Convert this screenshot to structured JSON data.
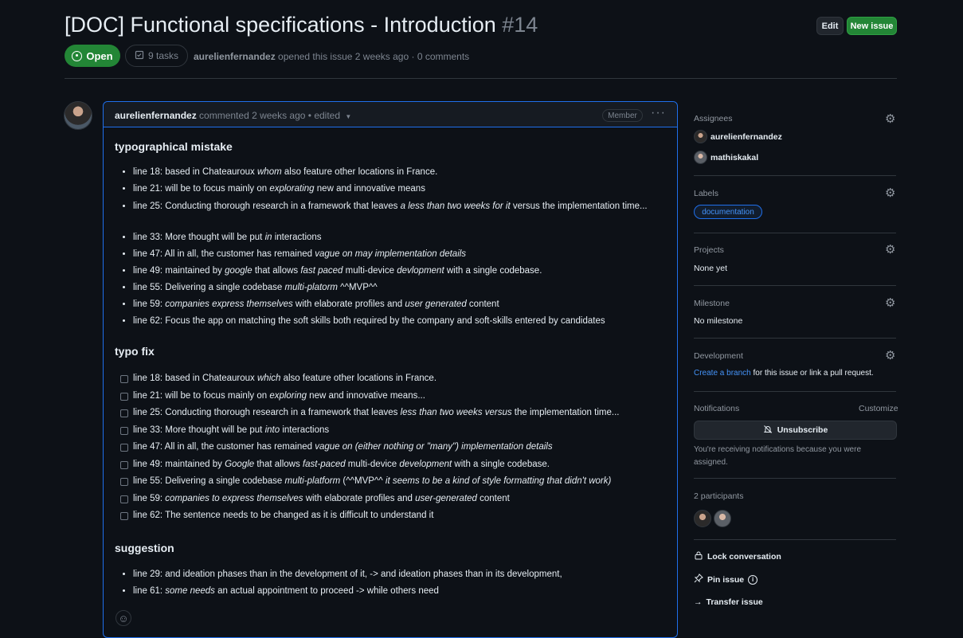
{
  "issue": {
    "title": "[DOC] Functional specifications - Introduction",
    "number": "#14",
    "status": "Open",
    "tasks": "9 tasks",
    "author": "aurelienfernandez",
    "opened_text": "opened this issue 2 weeks ago · 0 comments",
    "edit_label": "Edit",
    "new_issue_label": "New issue"
  },
  "comment": {
    "author": "aurelienfernandez",
    "meta": "commented 2 weeks ago • edited",
    "role": "Member",
    "menu": "···",
    "sections": {
      "typo_mistake": {
        "heading": "typographical mistake",
        "items": [
          [
            "line 18: based in Chateauroux ",
            "whom",
            " also feature other locations in France."
          ],
          [
            "line 21: will be to focus mainly on ",
            "explorating",
            " new and innovative means"
          ],
          [
            "line 25: Conducting thorough research in a framework that leaves ",
            "a less than two weeks for it",
            " versus the implementation time..."
          ],
          [
            "line 33: More thought will be put ",
            "in",
            " interactions"
          ],
          [
            "line 47: All in all, the customer has remained ",
            "vague on may implementation details",
            ""
          ],
          [
            "line 49: maintained by ",
            "google",
            " that allows ",
            "fast paced",
            " multi-device ",
            "devlopment",
            " with a single codebase."
          ],
          [
            "line 55: Delivering a single codebase ",
            "multi-platorm",
            " ^^MVP^^"
          ],
          [
            "line 59: ",
            "companies express themselves",
            " with elaborate profiles and ",
            "user generated",
            " content"
          ],
          [
            "line 62: Focus the app on matching the soft skills both required by the company and soft-skills entered by candidates"
          ]
        ]
      },
      "typo_fix": {
        "heading": "typo fix",
        "items": [
          [
            "line 18: based in Chateauroux ",
            "which",
            " also feature other locations in France."
          ],
          [
            "line 21: will be to focus mainly on ",
            "exploring",
            " new and innovative means..."
          ],
          [
            "line 25: Conducting thorough research in a framework that leaves ",
            "less than two weeks versus",
            " the implementation time..."
          ],
          [
            "line 33: More thought will be put ",
            "into",
            " interactions"
          ],
          [
            "line 47: All in all, the customer has remained ",
            "vague on (either nothing or \"many\") implementation details",
            ""
          ],
          [
            "line 49: maintained by ",
            "Google",
            " that allows ",
            "fast-paced",
            " multi-device ",
            "development",
            " with a single codebase."
          ],
          [
            "line 55: Delivering a single codebase ",
            "multi-platform",
            " (^^MVP^^ ",
            "it seems to be a kind of style formatting that didn't work)",
            ""
          ],
          [
            "line 59: ",
            "companies to express themselves",
            " with elaborate profiles and ",
            "user-generated",
            " content"
          ],
          [
            "line 62: The sentence needs to be changed as it is difficult to understand it"
          ]
        ]
      },
      "suggestion": {
        "heading": "suggestion",
        "items": [
          [
            "line 29: and ideation phases than in the development of it, -> and ideation phases than in its development,"
          ],
          [
            "line 61: ",
            "some needs",
            " an actual appointment to proceed -> while others need"
          ]
        ]
      }
    }
  },
  "sidebar": {
    "assignees": {
      "label": "Assignees",
      "users": [
        "aurelienfernandez",
        "mathiskakal"
      ]
    },
    "labels": {
      "label": "Labels",
      "value": "documentation"
    },
    "projects": {
      "label": "Projects",
      "value": "None yet"
    },
    "milestone": {
      "label": "Milestone",
      "value": "No milestone"
    },
    "development": {
      "label": "Development",
      "link": "Create a branch",
      "text": " for this issue or link a pull request."
    },
    "notifications": {
      "label": "Notifications",
      "customize": "Customize",
      "button": "Unsubscribe",
      "note": "You're receiving notifications because you were assigned."
    },
    "participants": {
      "label": "2 participants"
    },
    "actions": {
      "lock": "Lock conversation",
      "pin": "Pin issue",
      "transfer": "Transfer issue"
    }
  },
  "colors": {
    "accent": "#1f6feb",
    "open": "#238636",
    "link": "#4493f8",
    "bg": "#0d1117"
  }
}
